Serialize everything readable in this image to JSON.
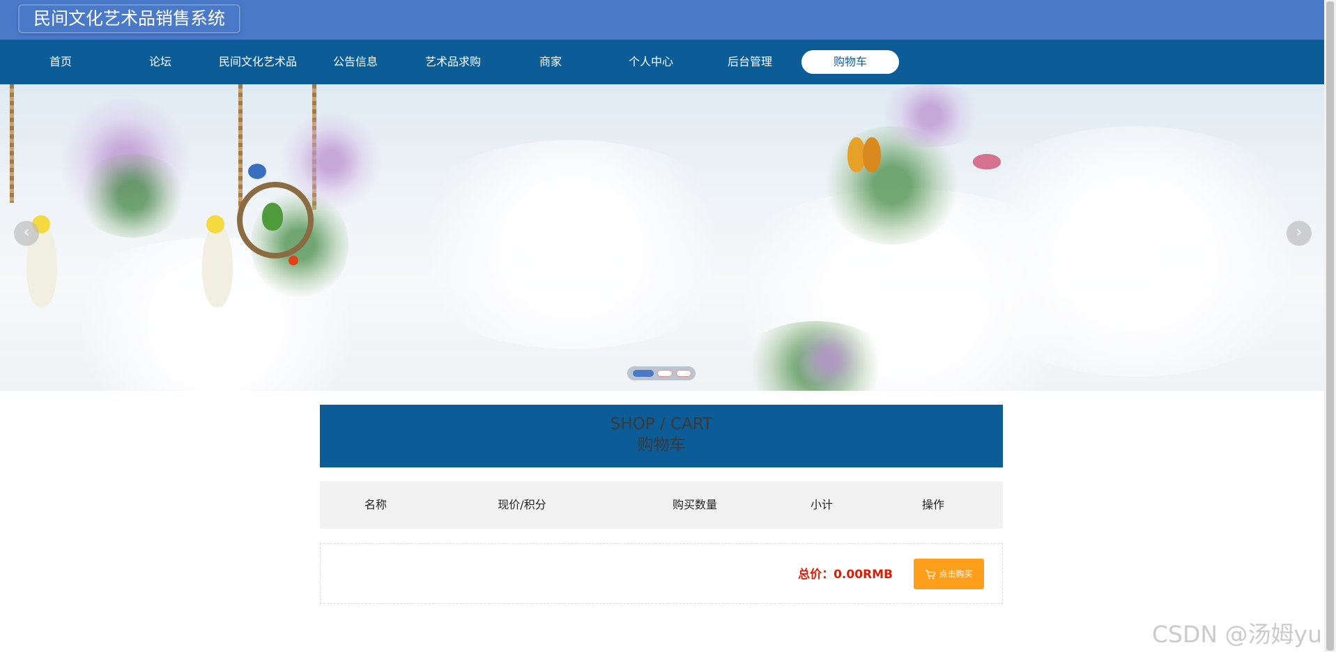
{
  "header": {
    "site_title": "民间文化艺术品销售系统"
  },
  "nav": {
    "items": [
      {
        "label": "首页"
      },
      {
        "label": "论坛"
      },
      {
        "label": "民间文化艺术品"
      },
      {
        "label": "公告信息"
      },
      {
        "label": "艺术品求购"
      },
      {
        "label": "商家"
      },
      {
        "label": "个人中心"
      },
      {
        "label": "后台管理"
      },
      {
        "label": "购物车"
      }
    ],
    "active_index": 8
  },
  "banner": {
    "prev_icon": "chevron-left-icon",
    "next_icon": "chevron-right-icon",
    "slide_count": 3,
    "active_slide": 1
  },
  "cart": {
    "title_en": "SHOP / CART",
    "title_cn": "购物车",
    "columns": [
      "名称",
      "现价/积分",
      "购买数量",
      "小计",
      "操作"
    ],
    "rows": [],
    "total_label": "总价：0.00RMB",
    "buy_label": "点击购买"
  },
  "watermark": "CSDN @汤姆yu",
  "colors": {
    "top_bar": "#4a79c8",
    "nav_bar": "#0b5c97",
    "total_red": "#d81e06",
    "buy_orange": "#ff9e1b"
  }
}
